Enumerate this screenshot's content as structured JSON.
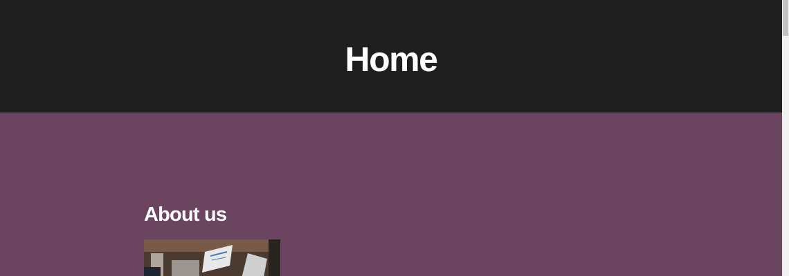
{
  "hero": {
    "title": "Home"
  },
  "content": {
    "heading": "About us",
    "image_icon": "office-documents-photo"
  },
  "colors": {
    "hero_background": "#1e1e1e",
    "content_background": "#6b4460",
    "text": "#ffffff"
  }
}
